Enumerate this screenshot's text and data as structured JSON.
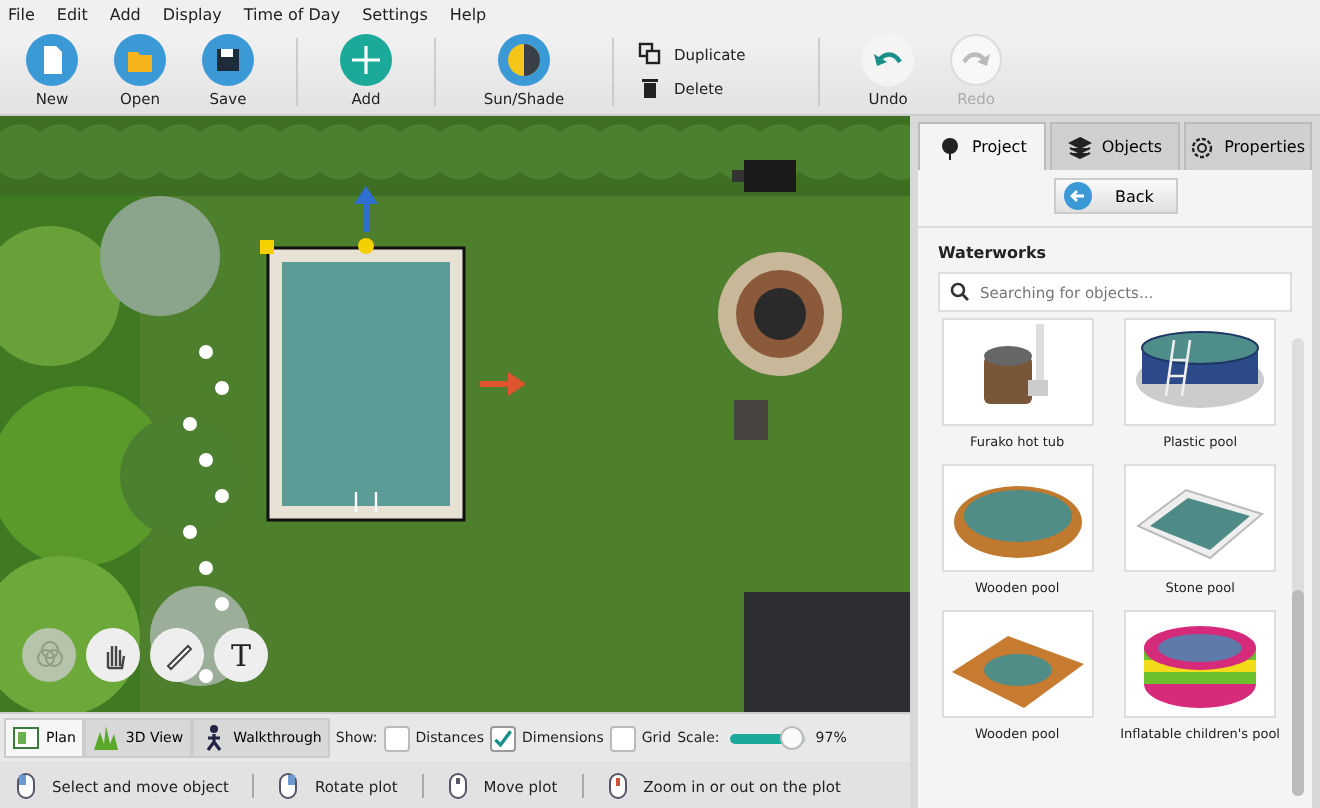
{
  "menu": [
    "File",
    "Edit",
    "Add",
    "Display",
    "Time of Day",
    "Settings",
    "Help"
  ],
  "toolbar": [
    {
      "kind": "new",
      "label": "New",
      "disabled": false
    },
    {
      "kind": "open",
      "label": "Open",
      "disabled": false
    },
    {
      "kind": "save",
      "label": "Save",
      "disabled": false
    },
    {
      "kind": "sep"
    },
    {
      "kind": "add",
      "label": "Add",
      "disabled": false
    },
    {
      "kind": "sep"
    },
    {
      "kind": "sun",
      "label": "Sun/Shade",
      "disabled": false
    },
    {
      "kind": "sep"
    },
    {
      "kind": "pair",
      "items": [
        {
          "kind": "duplicate",
          "label": "Duplicate"
        },
        {
          "kind": "delete",
          "label": "Delete"
        }
      ]
    },
    {
      "kind": "sep"
    },
    {
      "kind": "undo",
      "label": "Undo",
      "disabled": false
    },
    {
      "kind": "redo",
      "label": "Redo",
      "disabled": true
    }
  ],
  "canvas_tools": [
    {
      "kind": "shrub",
      "disabled": true
    },
    {
      "kind": "hand",
      "disabled": false
    },
    {
      "kind": "ruler",
      "disabled": false
    },
    {
      "kind": "text",
      "label": "T",
      "disabled": false
    }
  ],
  "view_tabs": [
    {
      "kind": "plan",
      "label": "Plan",
      "selected": true
    },
    {
      "kind": "threed",
      "label": "3D View",
      "selected": false
    },
    {
      "kind": "walk",
      "label": "Walkthrough",
      "selected": false
    }
  ],
  "show": {
    "label": "Show:",
    "options": [
      {
        "label": "Distances",
        "checked": false
      },
      {
        "label": "Dimensions",
        "checked": true
      },
      {
        "label": "Grid",
        "checked": false
      }
    ]
  },
  "scale": {
    "label": "Scale:",
    "level": 0.97,
    "reading": "97%"
  },
  "status_bar": [
    {
      "kind": "left",
      "label": "Select and move object"
    },
    {
      "kind": "right",
      "label": "Rotate plot"
    },
    {
      "kind": "middle",
      "label": "Move plot"
    },
    {
      "kind": "wheel",
      "label": "Zoom in or out on the plot"
    }
  ],
  "panel": {
    "tabs": [
      {
        "kind": "project",
        "label": "Project",
        "selected": true
      },
      {
        "kind": "objects",
        "label": "Objects",
        "selected": false
      },
      {
        "kind": "properties",
        "label": "Properties",
        "selected": false
      }
    ],
    "back": "Back",
    "section": "Waterworks",
    "search": {
      "placeholder": "Searching for objects..."
    },
    "objects": [
      {
        "kind": "hottub",
        "label": "Furako hot tub"
      },
      {
        "kind": "round",
        "label": "Plastic pool"
      },
      {
        "kind": "oval",
        "label": "Wooden pool"
      },
      {
        "kind": "rect",
        "label": "Stone pool"
      },
      {
        "kind": "deck",
        "label": "Wooden pool"
      },
      {
        "kind": "inflatable",
        "label": "Inflatable children's pool"
      }
    ]
  }
}
